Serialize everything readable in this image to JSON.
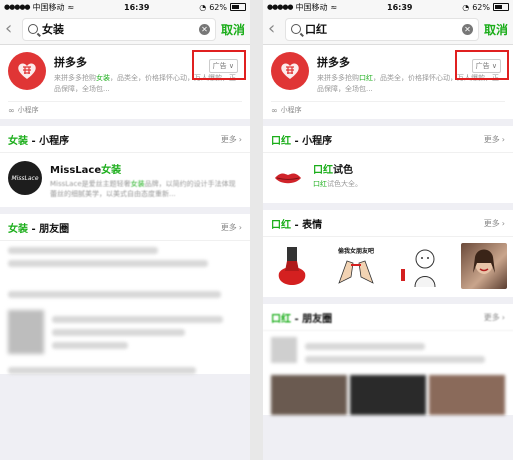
{
  "left": {
    "status": {
      "carrier": "中国移动",
      "time": "16:39",
      "battery": "62%"
    },
    "search": {
      "query": "女装",
      "cancel": "取消"
    },
    "ad": {
      "title": "拼多多",
      "desc_pre": "来拼多多抢购",
      "desc_kw": "女装",
      "desc_post": "，品类全，价格择怀心动，万人爆款，正品保障，全场包...",
      "badge": "广告 ∨",
      "mini_tag": "小程序"
    },
    "miniprogram": {
      "kw": "女装",
      "title_suffix": " - 小程序",
      "more": "更多",
      "item_title_pre": "MissLace",
      "item_title_kw": "女装",
      "item_logo": "MissLace",
      "item_desc_pre": "MissLace是爱丝主题轻奢",
      "item_desc_kw": "女装",
      "item_desc_post": "品牌，以简约的设计手法体现蕾丝的细腻美学，以美式自由态度重新..."
    },
    "moments": {
      "kw": "女装",
      "title_suffix": " - 朋友圈",
      "more": "更多"
    }
  },
  "right": {
    "status": {
      "carrier": "中国移动",
      "time": "16:39",
      "battery": "62%"
    },
    "search": {
      "query": "口红",
      "cancel": "取消"
    },
    "ad": {
      "title": "拼多多",
      "desc_pre": "来拼多多抢购",
      "desc_kw": "口红",
      "desc_post": "，品类全，价格择怀心动，万人爆款，正品保障，全场包...",
      "badge": "广告 ∨",
      "mini_tag": "小程序"
    },
    "miniprogram": {
      "kw": "口红",
      "title_suffix": " - 小程序",
      "more": "更多",
      "item_title_kw": "口红",
      "item_title_post": "试色",
      "item_desc_kw": "口红",
      "item_desc_post": "试色大全。"
    },
    "stickers": {
      "kw": "口红",
      "title_suffix": " - 表情",
      "more": "更多",
      "caption2": "偷我女朋友吧"
    },
    "moments": {
      "kw": "口红",
      "title_suffix": " - 朋友圈",
      "more": "更多"
    }
  },
  "colors": {
    "accent": "#1aad19",
    "highlight_box": "#e02020",
    "brand_red": "#e03535"
  }
}
